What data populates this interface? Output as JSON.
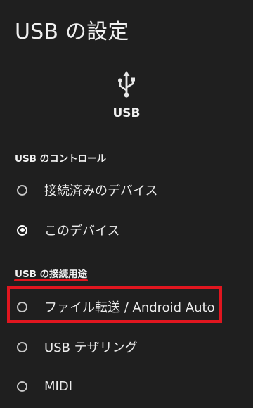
{
  "page": {
    "title": "USB の設定"
  },
  "header_icon": {
    "icon": "usb-icon",
    "label": "USB"
  },
  "usb_control": {
    "header": "USB のコントロール",
    "options": [
      {
        "label": "接続済みのデバイス",
        "selected": false
      },
      {
        "label": "このデバイス",
        "selected": true
      }
    ]
  },
  "usb_purpose": {
    "header": "USB の接続用途",
    "options": [
      {
        "label": "ファイル転送 / Android Auto",
        "selected": false
      },
      {
        "label": "USB テザリング",
        "selected": false
      },
      {
        "label": "MIDI",
        "selected": false
      }
    ]
  },
  "colors": {
    "background": "#1f1f1f",
    "annotation_red": "#e0161f"
  }
}
